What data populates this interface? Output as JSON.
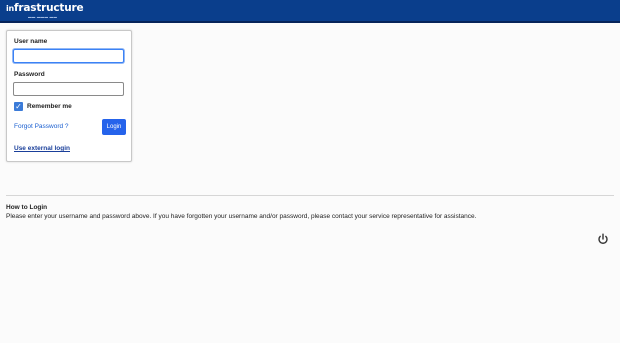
{
  "header": {
    "logo_text": "frastructure",
    "logo_prefix": "in",
    "bg_color": "#0a3e8c"
  },
  "login": {
    "username_label": "User name",
    "username_value": "",
    "password_label": "Password",
    "password_value": "",
    "remember_label": "Remember me",
    "remember_checked": true,
    "forgot_label": "Forgot Password ?",
    "login_button": "Login",
    "external_login": "Use external login",
    "accent_color": "#2563eb"
  },
  "help": {
    "title": "How to Login",
    "text": "Please enter your username and password above. If you have forgotten your username and/or password, please contact your service representative for assistance."
  },
  "icons": {
    "power": "power-icon",
    "check": "check-icon"
  }
}
